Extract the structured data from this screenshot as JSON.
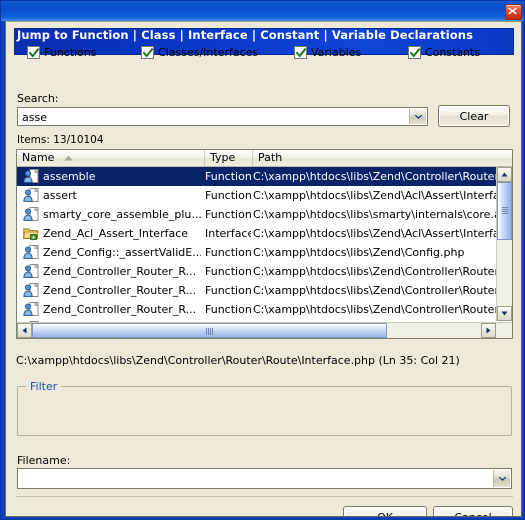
{
  "window": {
    "close_icon": "close-icon",
    "header_title": "Jump to Function | Class | Interface | Constant | Variable  Declarations"
  },
  "search": {
    "label": "Search:",
    "value": "asse",
    "clear_label": "Clear",
    "dropdown_icon": "chevron-down-icon"
  },
  "items": {
    "count_label": "Items:  13/10104"
  },
  "list": {
    "columns": [
      {
        "label": "Name",
        "sort": "ascending"
      },
      {
        "label": "Type",
        "sort": ""
      },
      {
        "label": "Path",
        "sort": ""
      }
    ],
    "rows": [
      {
        "icon": "function-icon",
        "name": "assemble",
        "type": "Function",
        "path": "C:\\xampp\\htdocs\\libs\\Zend\\Controller\\Router\\Rou",
        "selected": true
      },
      {
        "icon": "function-icon",
        "name": "assert",
        "type": "Function",
        "path": "C:\\xampp\\htdocs\\libs\\Zend\\Acl\\Assert\\Interface.p",
        "selected": false
      },
      {
        "icon": "function-icon",
        "name": "smarty_core_assemble_plu...",
        "type": "Function",
        "path": "C:\\xampp\\htdocs\\libs\\smarty\\internals\\core.assem",
        "selected": false
      },
      {
        "icon": "interface-icon",
        "name": "Zend_Acl_Assert_Interface",
        "type": "Interface",
        "path": "C:\\xampp\\htdocs\\libs\\Zend\\Acl\\Assert\\Interface.p",
        "selected": false
      },
      {
        "icon": "function-icon",
        "name": "Zend_Config::_assertValidE...",
        "type": "Function",
        "path": "C:\\xampp\\htdocs\\libs\\Zend\\Config.php",
        "selected": false
      },
      {
        "icon": "function-icon",
        "name": "Zend_Controller_Router_R...",
        "type": "Function",
        "path": "C:\\xampp\\htdocs\\libs\\Zend\\Controller\\Router\\Rou",
        "selected": false
      },
      {
        "icon": "function-icon",
        "name": "Zend_Controller_Router_R...",
        "type": "Function",
        "path": "C:\\xampp\\htdocs\\libs\\Zend\\Controller\\Router\\Rou",
        "selected": false
      },
      {
        "icon": "function-icon",
        "name": "Zend_Controller_Router_R...",
        "type": "Function",
        "path": "C:\\xampp\\htdocs\\libs\\Zend\\Controller\\Router\\Rou",
        "selected": false
      },
      {
        "icon": "function-icon",
        "name": "Zend_Controller_Router_R...",
        "type": "Function",
        "path": "C:\\xampp\\htdocs\\libs\\Zend\\Controller\\Router\\Rou",
        "selected": false
      }
    ],
    "scroll_up_icon": "chevron-up-icon",
    "scroll_down_icon": "chevron-down-icon",
    "scroll_left_icon": "chevron-left-icon",
    "scroll_right_icon": "chevron-right-icon"
  },
  "status": {
    "path": "C:\\xampp\\htdocs\\libs\\Zend\\Controller\\Router\\Route\\Interface.php (Ln 35: Col 21)"
  },
  "filter": {
    "title": "Filter",
    "checkboxes": [
      {
        "label": "Functions",
        "checked": true
      },
      {
        "label": "Classes/Interfaces",
        "checked": true
      },
      {
        "label": "Variables",
        "checked": true
      },
      {
        "label": "Constants",
        "checked": true
      }
    ],
    "check_icon": "checkmark-icon"
  },
  "filename": {
    "label": "Filename:",
    "value": "",
    "dropdown_icon": "chevron-down-icon"
  },
  "buttons": {
    "ok": "OK",
    "cancel": "Cancel"
  },
  "colors": {
    "dialog_bg": "#ece9d8",
    "titlebar_blue": "#0a4fcb",
    "header_band": "#0a37c4",
    "selection": "#0a246a",
    "group_title": "#16529e",
    "check_green": "#1a7a1a"
  }
}
